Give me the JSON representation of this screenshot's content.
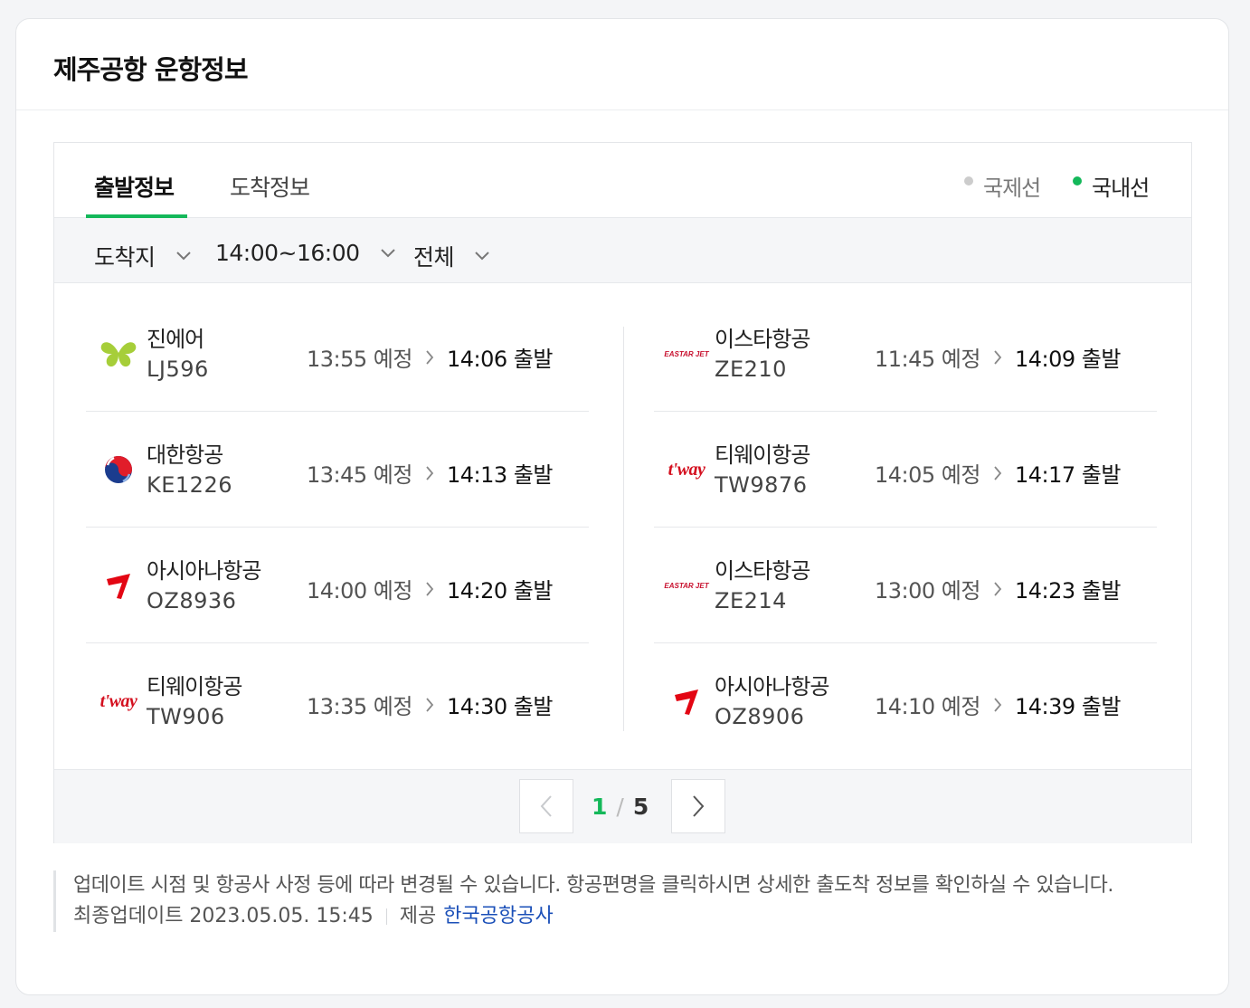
{
  "title": "제주공항 운항정보",
  "tabs": [
    {
      "label": "출발정보",
      "active": true
    },
    {
      "label": "도착정보",
      "active": false
    }
  ],
  "legend": {
    "international": {
      "label": "국제선",
      "color": "#cccccc"
    },
    "domestic": {
      "label": "국내선",
      "color": "#14b85a"
    }
  },
  "filters": {
    "destination": "도착지",
    "time_range": "14:00~16:00",
    "scope": "전체"
  },
  "flights": [
    {
      "airline": "진에어",
      "flight": "LJ596",
      "scheduled": "13:55 예정",
      "actual": "14:06 출발",
      "logo": "jinair-butterfly-icon"
    },
    {
      "airline": "대한항공",
      "flight": "KE1226",
      "scheduled": "13:45 예정",
      "actual": "14:13 출발",
      "logo": "koreanair-taegeuk-icon"
    },
    {
      "airline": "아시아나항공",
      "flight": "OZ8936",
      "scheduled": "14:00 예정",
      "actual": "14:20 출발",
      "logo": "asiana-wing-icon"
    },
    {
      "airline": "티웨이항공",
      "flight": "TW906",
      "scheduled": "13:35 예정",
      "actual": "14:30 출발",
      "logo": "tway-logo"
    },
    {
      "airline": "이스타항공",
      "flight": "ZE210",
      "scheduled": "11:45 예정",
      "actual": "14:09 출발",
      "logo": "eastarjet-logo"
    },
    {
      "airline": "티웨이항공",
      "flight": "TW9876",
      "scheduled": "14:05 예정",
      "actual": "14:17 출발",
      "logo": "tway-logo"
    },
    {
      "airline": "이스타항공",
      "flight": "ZE214",
      "scheduled": "13:00 예정",
      "actual": "14:23 출발",
      "logo": "eastarjet-logo"
    },
    {
      "airline": "아시아나항공",
      "flight": "OZ8906",
      "scheduled": "14:10 예정",
      "actual": "14:39 출발",
      "logo": "asiana-wing-icon"
    }
  ],
  "pagination": {
    "current": "1",
    "separator": "/",
    "total": "5"
  },
  "notice": {
    "text": "업데이트 시점 및 항공사 사정 등에 따라 변경될 수 있습니다. 항공편명을 클릭하시면 상세한 출도착 정보를 확인하실 수 있습니다.",
    "updated": "최종업데이트 2023.05.05. 15:45",
    "provider_label": "제공",
    "provider_name": "한국공항공사"
  },
  "logos": {
    "tway": "t'way",
    "eastar": "EASTAR JET"
  },
  "colors": {
    "accent": "#14b85a",
    "link": "#1a4fb8",
    "asiana": "#e30613",
    "tway": "#d4101f",
    "jinair": "#a6ce39"
  }
}
